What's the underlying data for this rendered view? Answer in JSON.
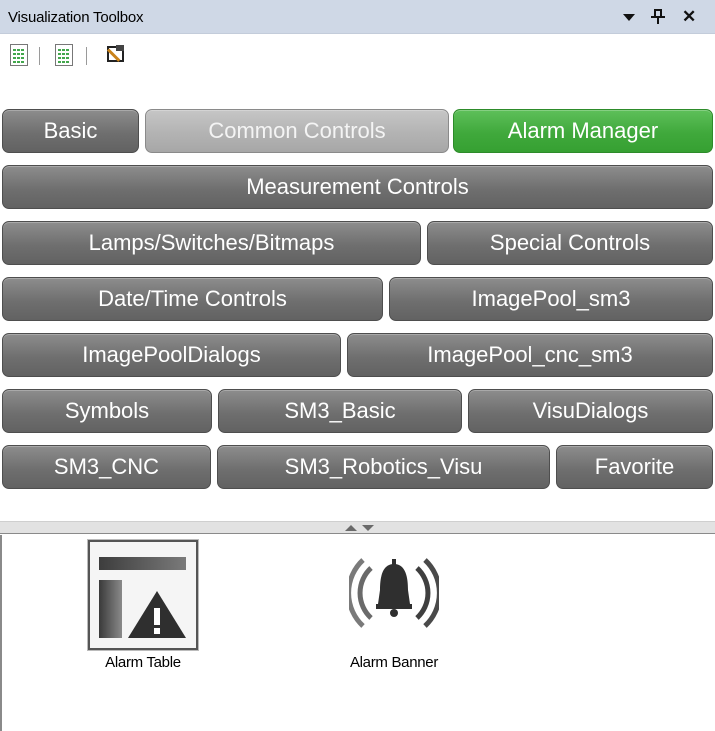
{
  "window": {
    "title": "Visualization Toolbox"
  },
  "toolbar": {
    "icons": [
      "list-view-icon",
      "grid-view-icon",
      "image-tool-icon"
    ]
  },
  "tabs": [
    {
      "label": "Basic",
      "state": "normal"
    },
    {
      "label": "Common Controls",
      "state": "light"
    },
    {
      "label": "Alarm Manager",
      "state": "active"
    },
    {
      "label": "Measurement Controls",
      "state": "normal"
    },
    {
      "label": "Lamps/Switches/Bitmaps",
      "state": "normal"
    },
    {
      "label": "Special Controls",
      "state": "normal"
    },
    {
      "label": "Date/Time Controls",
      "state": "normal"
    },
    {
      "label": "ImagePool_sm3",
      "state": "normal"
    },
    {
      "label": "ImagePoolDialogs",
      "state": "normal"
    },
    {
      "label": "ImagePool_cnc_sm3",
      "state": "normal"
    },
    {
      "label": "Symbols",
      "state": "normal"
    },
    {
      "label": "SM3_Basic",
      "state": "normal"
    },
    {
      "label": "VisuDialogs",
      "state": "normal"
    },
    {
      "label": "SM3_CNC",
      "state": "normal"
    },
    {
      "label": "SM3_Robotics_Visu",
      "state": "normal"
    },
    {
      "label": "Favorite",
      "state": "normal"
    }
  ],
  "items": [
    {
      "label": "Alarm Table",
      "icon": "alarm-table-icon",
      "selected": true
    },
    {
      "label": "Alarm Banner",
      "icon": "alarm-banner-icon",
      "selected": false
    }
  ],
  "colors": {
    "title_bg": "#cfd8e6",
    "tab_normal": "#6f6f6f",
    "tab_light": "#b3b3b3",
    "tab_active": "#40a93c"
  }
}
